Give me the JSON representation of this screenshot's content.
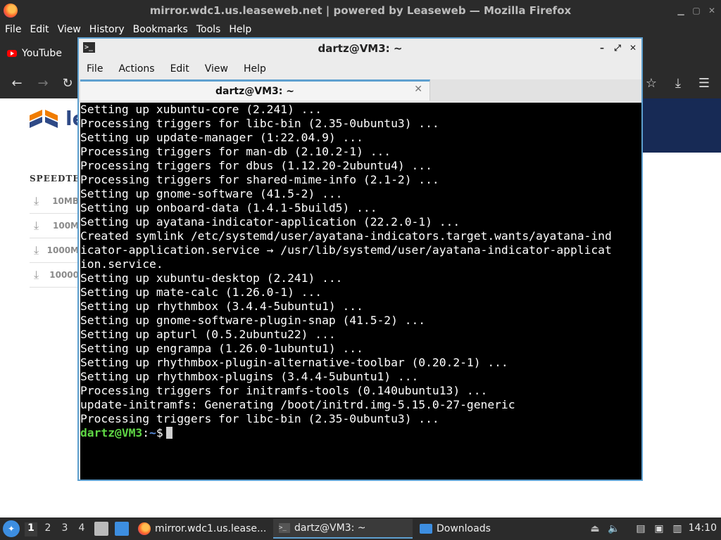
{
  "firefox": {
    "title": "mirror.wdc1.us.leaseweb.net | powered by Leaseweb — Mozilla Firefox",
    "menu": [
      "File",
      "Edit",
      "View",
      "History",
      "Bookmarks",
      "Tools",
      "Help"
    ],
    "bookmark": "YouTube"
  },
  "page": {
    "logo_text": "le",
    "section": "SPEEDTES",
    "downloads": [
      "10MB",
      "100M",
      "1000M",
      "10000"
    ]
  },
  "terminal": {
    "title": "dartz@VM3: ~",
    "menu": [
      "File",
      "Actions",
      "Edit",
      "View",
      "Help"
    ],
    "tab_label": "dartz@VM3: ~",
    "lines": [
      "Setting up xubuntu-core (2.241) ...",
      "Processing triggers for libc-bin (2.35-0ubuntu3) ...",
      "Setting up update-manager (1:22.04.9) ...",
      "Processing triggers for man-db (2.10.2-1) ...",
      "Processing triggers for dbus (1.12.20-2ubuntu4) ...",
      "Processing triggers for shared-mime-info (2.1-2) ...",
      "Setting up gnome-software (41.5-2) ...",
      "Setting up onboard-data (1.4.1-5build5) ...",
      "Setting up ayatana-indicator-application (22.2.0-1) ...",
      "Created symlink /etc/systemd/user/ayatana-indicators.target.wants/ayatana-ind",
      "icator-application.service → /usr/lib/systemd/user/ayatana-indicator-applicat",
      "ion.service.",
      "Setting up xubuntu-desktop (2.241) ...",
      "Setting up mate-calc (1.26.0-1) ...",
      "Setting up rhythmbox (3.4.4-5ubuntu1) ...",
      "Setting up gnome-software-plugin-snap (41.5-2) ...",
      "Setting up apturl (0.5.2ubuntu22) ...",
      "Setting up engrampa (1.26.0-1ubuntu1) ...",
      "Setting up rhythmbox-plugin-alternative-toolbar (0.20.2-1) ...",
      "Setting up rhythmbox-plugins (3.4.4-5ubuntu1) ...",
      "Processing triggers for initramfs-tools (0.140ubuntu13) ...",
      "update-initramfs: Generating /boot/initrd.img-5.15.0-27-generic",
      "Processing triggers for libc-bin (2.35-0ubuntu3) ..."
    ],
    "prompt_user": "dartz@VM3",
    "prompt_sep": ":",
    "prompt_path": "~",
    "prompt_end": "$"
  },
  "taskbar": {
    "workspaces": [
      "1",
      "2",
      "3",
      "4"
    ],
    "tasks": [
      "mirror.wdc1.us.lease...",
      "dartz@VM3: ~",
      "Downloads"
    ],
    "clock": "14:10"
  }
}
